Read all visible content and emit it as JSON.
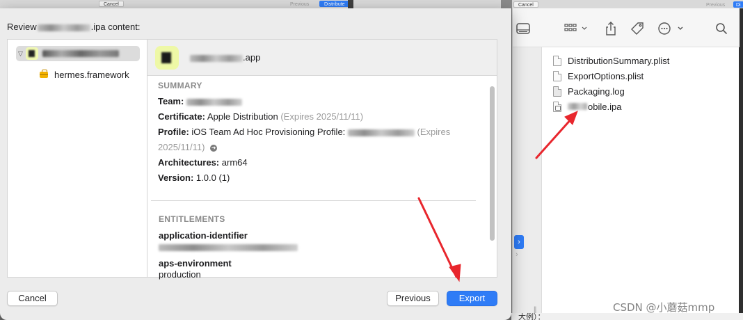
{
  "background": {
    "mini_cancel": "Cancel",
    "mini_previous": "Previous",
    "mini_distribute": "Distribute",
    "mini_cancel_2": "Cancel",
    "mini_previous_2": "Previous",
    "mini_distribute_2": "Di",
    "cjk_fragment": "大例）："
  },
  "dialog": {
    "title_prefix": "Review",
    "title_suffix": ".ipa content:",
    "tree": {
      "child_label": "hermes.framework"
    },
    "header": {
      "app_name_suffix": ".app"
    },
    "summary": {
      "heading": "SUMMARY",
      "team_label": "Team:",
      "certificate_label": "Certificate:",
      "certificate_value": "Apple Distribution",
      "certificate_expiry": "(Expires 2025/11/11)",
      "profile_label": "Profile:",
      "profile_value": "iOS Team Ad Hoc Provisioning Profile:",
      "profile_expiry_start": "(Expires",
      "profile_expiry_end": "2025/11/11)",
      "architectures_label": "Architectures:",
      "architectures_value": "arm64",
      "version_label": "Version:",
      "version_value": "1.0.0 (1)"
    },
    "entitlements": {
      "heading": "ENTITLEMENTS",
      "key_1": "application-identifier",
      "key_2": "aps-environment",
      "value_2": "production"
    },
    "buttons": {
      "cancel": "Cancel",
      "previous": "Previous",
      "export": "Export"
    }
  },
  "finder": {
    "files": [
      {
        "name": "DistributionSummary.plist",
        "icon": "plist-file-icon"
      },
      {
        "name": "ExportOptions.plist",
        "icon": "plist-file-icon"
      },
      {
        "name": "Packaging.log",
        "icon": "log-file-icon"
      },
      {
        "name": "obile.ipa",
        "icon": "ipa-file-icon"
      }
    ]
  },
  "watermark": "CSDN @小蘑菇mmp",
  "colors": {
    "accent": "#2f7cf6",
    "annotation_arrow": "#e8262d"
  }
}
